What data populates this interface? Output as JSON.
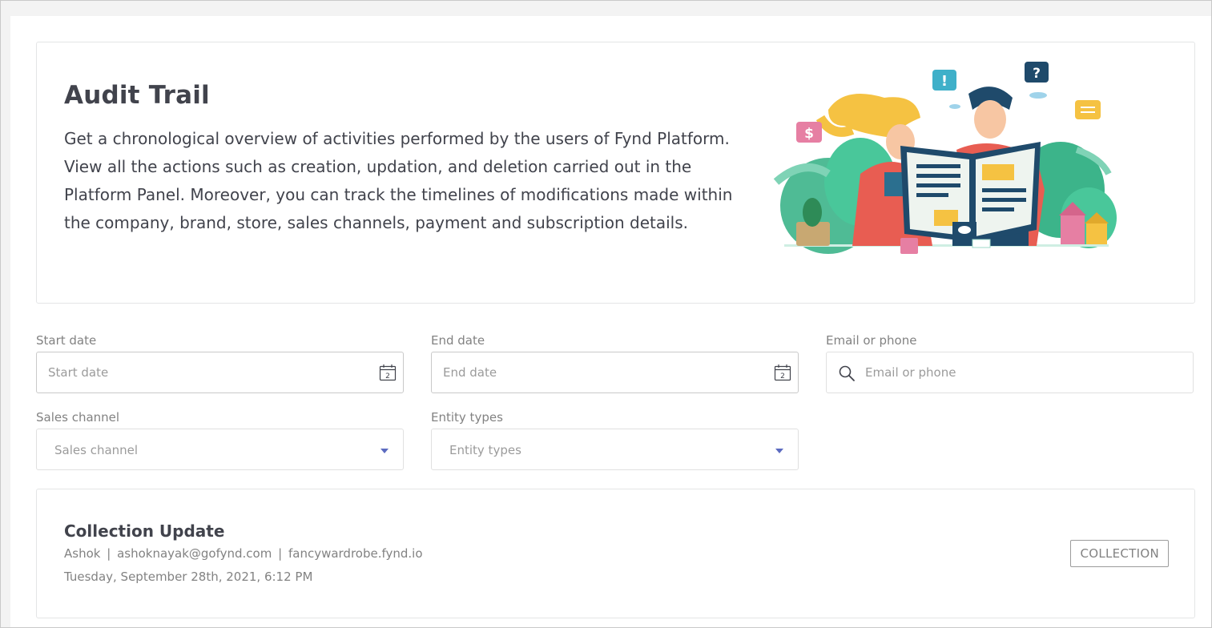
{
  "hero": {
    "title": "Audit Trail",
    "description": "Get a chronological overview of activities performed by the users of Fynd Platform. View all the actions such as creation, updation, and deletion carried out in the Platform Panel. Moreover, you can track the timelines of modifications made within the company, brand, store, sales channels, payment and subscription details.",
    "illustration": "people-reading-newspaper-illustration"
  },
  "filters": {
    "start_date": {
      "label": "Start date",
      "placeholder": "Start date",
      "value": "",
      "icon": "calendar-icon",
      "icon_day": "2"
    },
    "end_date": {
      "label": "End date",
      "placeholder": "End date",
      "value": "",
      "icon": "calendar-icon",
      "icon_day": "2"
    },
    "email_phone": {
      "label": "Email or phone",
      "placeholder": "Email or phone",
      "value": "",
      "icon": "search-icon"
    },
    "sales_channel": {
      "label": "Sales channel",
      "placeholder": "Sales channel",
      "icon": "chevron-down-icon"
    },
    "entity_types": {
      "label": "Entity types",
      "placeholder": "Entity types",
      "icon": "chevron-down-icon"
    }
  },
  "activities": [
    {
      "title": "Collection Update",
      "user": "Ashok",
      "email": "ashoknayak@gofynd.com",
      "domain": "fancywardrobe.fynd.io",
      "separator": "|",
      "timestamp": "Tuesday, September 28th, 2021, 6:12 PM",
      "badge": "COLLECTION"
    }
  ],
  "colors": {
    "text_primary": "#41434c",
    "text_muted": "#828282",
    "border": "#c9c9c9",
    "caret_accent": "#5c6bc0"
  }
}
